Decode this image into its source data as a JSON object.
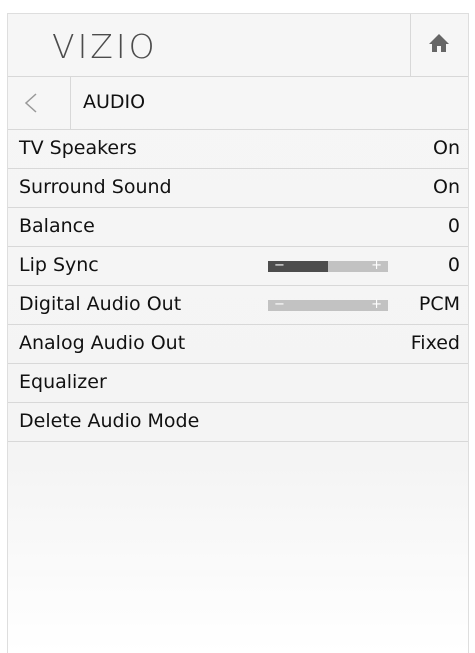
{
  "header": {
    "logo": "VIZIO",
    "home_icon": "home-icon"
  },
  "breadcrumb": {
    "back_icon": "back-arrow-icon",
    "title": "AUDIO"
  },
  "menu": {
    "tv_speakers": {
      "label": "TV Speakers",
      "value": "On"
    },
    "surround_sound": {
      "label": "Surround Sound",
      "value": "On"
    },
    "balance": {
      "label": "Balance",
      "value": "0"
    },
    "lip_sync": {
      "label": "Lip Sync",
      "value": "0",
      "slider_level": 0.5,
      "minus": "−",
      "plus": "+"
    },
    "digital_audio_out": {
      "label": "Digital Audio Out",
      "value": "PCM",
      "slider_level": 0.0,
      "minus": "−",
      "plus": "+"
    },
    "analog_audio_out": {
      "label": "Analog Audio Out",
      "value": "Fixed"
    },
    "equalizer": {
      "label": "Equalizer"
    },
    "delete_audio_mode": {
      "label": "Delete Audio Mode"
    }
  },
  "colors": {
    "slider_fill": "#4d4d4d",
    "slider_track": "#c2c2c2",
    "panel_bg": "#f4f4f4"
  }
}
